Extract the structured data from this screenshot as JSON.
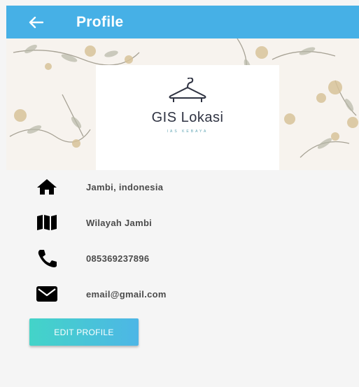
{
  "appbar": {
    "title": "Profile",
    "back_icon": "arrow-left-icon",
    "color": "#46b0e6"
  },
  "banner": {
    "logo_title": "GIS Lokasi",
    "logo_subtitle": "IAS KEBAYA",
    "logo_icon": "hanger-icon"
  },
  "info": {
    "items": [
      {
        "icon": "home-icon",
        "text": "Jambi, indonesia"
      },
      {
        "icon": "map-icon",
        "text": "Wilayah Jambi"
      },
      {
        "icon": "phone-icon",
        "text": "085369237896"
      },
      {
        "icon": "mail-icon",
        "text": "email@gmail.com"
      }
    ]
  },
  "actions": {
    "edit_label": "EDIT PROFILE",
    "button_colors": [
      "#43d4c8",
      "#4db6e6"
    ]
  }
}
